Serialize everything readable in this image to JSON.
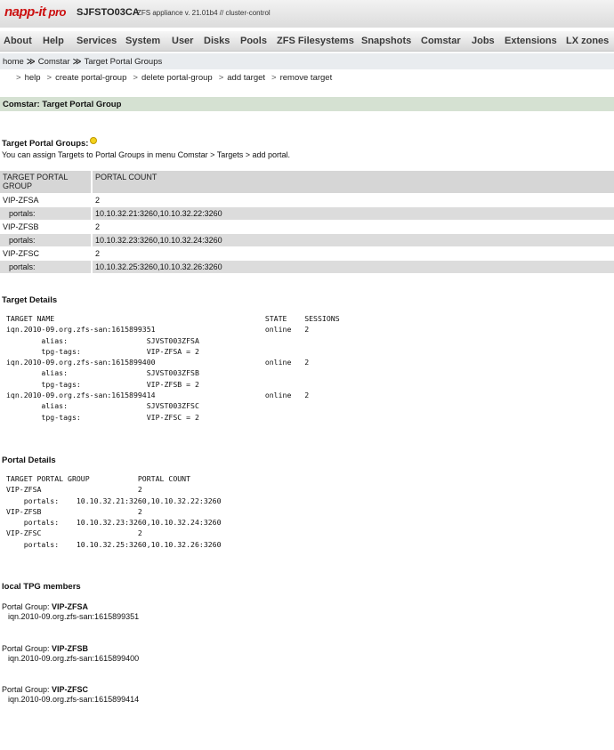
{
  "header": {
    "logo_name": "napp-it",
    "logo_pro": "pro",
    "hostname": "SJFSTO03CA",
    "version": "ZFS appliance v. 21.01b4 // cluster-control"
  },
  "menu": [
    "About",
    "Help",
    "Services",
    "System",
    "User",
    "Disks",
    "Pools",
    "ZFS Filesystems",
    "Snapshots",
    "Comstar",
    "Jobs",
    "Extensions",
    "LX zones"
  ],
  "breadcrumb": {
    "home": "home",
    "sep": "≫",
    "comstar": "Comstar",
    "page": "Target Portal Groups"
  },
  "subnav": {
    "sep": ">",
    "items": [
      "help",
      "create portal-group",
      "delete portal-group",
      "add target",
      "remove target"
    ]
  },
  "section_title": "Comstar: Target Portal Group",
  "tpg": {
    "heading": "Target Portal Groups:",
    "hint": "You can assign Targets to Portal Groups in menu Comstar > Targets > add portal.",
    "col1": "TARGET PORTAL GROUP",
    "col2": "PORTAL COUNT",
    "rows": [
      {
        "name": "VIP-ZFSA",
        "count": "2",
        "label": "portals:",
        "portals": "10.10.32.21:3260,10.10.32.22:3260"
      },
      {
        "name": "VIP-ZFSB",
        "count": "2",
        "label": "portals:",
        "portals": "10.10.32.23:3260,10.10.32.24:3260"
      },
      {
        "name": "VIP-ZFSC",
        "count": "2",
        "label": "portals:",
        "portals": "10.10.32.25:3260,10.10.32.26:3260"
      }
    ]
  },
  "target_details": {
    "heading": "Target Details",
    "text": "TARGET NAME                                                STATE    SESSIONS\niqn.2010-09.org.zfs-san:1615899351                         online   2\n        alias:                  SJVST003ZFSA\n        tpg-tags:               VIP-ZFSA = 2\niqn.2010-09.org.zfs-san:1615899400                         online   2\n        alias:                  SJVST003ZFSB\n        tpg-tags:               VIP-ZFSB = 2\niqn.2010-09.org.zfs-san:1615899414                         online   2\n        alias:                  SJVST003ZFSC\n        tpg-tags:               VIP-ZFSC = 2"
  },
  "portal_details": {
    "heading": "Portal Details",
    "text": "TARGET PORTAL GROUP           PORTAL COUNT\nVIP-ZFSA                      2\n    portals:    10.10.32.21:3260,10.10.32.22:3260\nVIP-ZFSB                      2\n    portals:    10.10.32.23:3260,10.10.32.24:3260\nVIP-ZFSC                      2\n    portals:    10.10.32.25:3260,10.10.32.26:3260"
  },
  "members": {
    "heading": "local TPG members",
    "label": "Portal Group:",
    "groups": [
      {
        "name": "VIP-ZFSA",
        "iqn": "iqn.2010-09.org.zfs-san:1615899351"
      },
      {
        "name": "VIP-ZFSB",
        "iqn": "iqn.2010-09.org.zfs-san:1615899400"
      },
      {
        "name": "VIP-ZFSC",
        "iqn": "iqn.2010-09.org.zfs-san:1615899414"
      }
    ]
  }
}
